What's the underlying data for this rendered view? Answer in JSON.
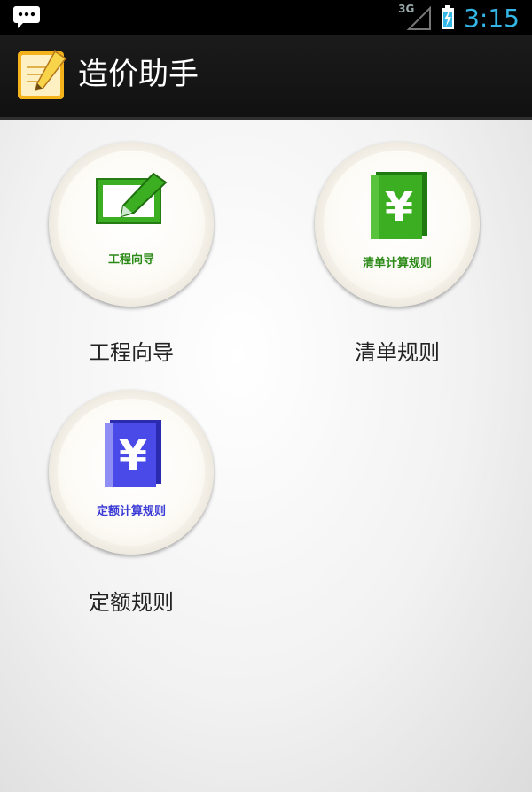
{
  "status_bar": {
    "network_type": "3G",
    "time": "3:15",
    "notification_icon": "message-icon",
    "signal_icon": "signal-icon",
    "battery_icon": "battery-charging-icon"
  },
  "action_bar": {
    "title": "造价助手",
    "app_icon": "notepad-app-icon"
  },
  "tiles": [
    {
      "icon": "edit-pencil-icon",
      "badge": "工程向导",
      "label": "工程向导",
      "color": "#2b8a17"
    },
    {
      "icon": "yuan-book-green-icon",
      "badge": "清单计算规则",
      "label": "清单规则",
      "color": "#2b8a17"
    },
    {
      "icon": "yuan-book-blue-icon",
      "badge": "定额计算规则",
      "label": "定额规则",
      "color": "#3b3bd6"
    }
  ]
}
